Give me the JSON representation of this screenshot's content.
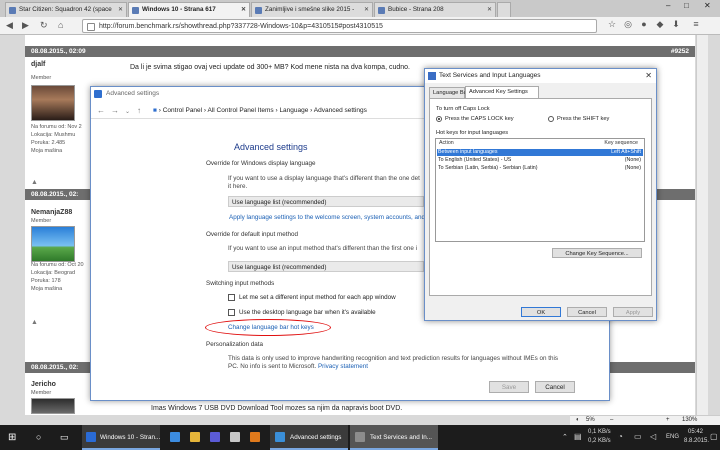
{
  "browser": {
    "tabs": [
      {
        "label": "Star Citizen: Squadron 42 (space"
      },
      {
        "label": "Windows 10 - Strana 617"
      },
      {
        "label": "Zanimljive i smešne slike 2015 -"
      },
      {
        "label": "Bubice - Strana 208"
      }
    ],
    "url": "http://forum.benchmark.rs/showthread.php?337728-Windows-10&p=4310515#post4310515"
  },
  "forum": {
    "posts": [
      {
        "date": "08.08.2015., 02:09",
        "number": "#9252",
        "username": "djalf",
        "role": "Member",
        "meta": [
          "Na forumu od: Nov 2",
          "Lokacija: Mushmu",
          "Poruka: 2.485",
          "Moja mašina"
        ],
        "text": "Da li je svima stigao ovaj veci update od 300+ MB? Kod mene nista na dva kompa, cudno."
      },
      {
        "date": "08.08.2015., 02:",
        "username": "NemanjaZ88",
        "role": "Member",
        "meta": [
          "Na forumu od: Oct 20",
          "Lokacija: Beograd",
          "Poruka: 178",
          "Moja mašina"
        ]
      },
      {
        "date": "08.08.2015., 02:",
        "username": "Jericho",
        "role": "Member",
        "text": "Imas Windows 7 USB DVD Download Tool mozes sa njim da napravis boot DVD."
      }
    ]
  },
  "advanced_settings": {
    "title": "Advanced settings",
    "breadcrumbs": [
      "Control Panel",
      "All Control Panel Items",
      "Language",
      "Advanced settings"
    ],
    "heading": "Advanced settings",
    "override_display": {
      "title": "Override for Windows display language",
      "desc": "If you want to use a display language that's different than the one det",
      "desc2": "it here.",
      "select": "Use language list (recommended)",
      "link": "Apply language settings to the welcome screen, system accounts, and"
    },
    "override_input": {
      "title": "Override for default input method",
      "desc": "If you want to use an input method that's different than the first one i",
      "select": "Use language list (recommended)"
    },
    "switching": {
      "title": "Switching input methods",
      "opt1": "Let me set a different input method for each app window",
      "opt2": "Use the desktop language bar when it's available",
      "hotkeys_link": "Change language bar hot keys"
    },
    "personalization": {
      "title": "Personalization data",
      "desc": "This data is only used to improve handwriting recognition and text prediction results for languages without IMEs on this",
      "desc2": "PC. No info is sent to Microsoft.",
      "privacy_link": "Privacy statement"
    },
    "save": "Save",
    "cancel": "Cancel"
  },
  "text_services": {
    "title": "Text Services and Input Languages",
    "tabs": [
      "Language Bar",
      "Advanced Key Settings"
    ],
    "caps_group": "To turn off Caps Lock",
    "caps_opt1": "Press the CAPS LOCK key",
    "caps_opt2": "Press the SHIFT key",
    "hotkeys_group": "Hot keys for input languages",
    "col_action": "Action",
    "col_key": "Key sequence",
    "rows": [
      {
        "action": "Between input languages",
        "key": "Left Alt+Shift"
      },
      {
        "action": "To English (United States) - US",
        "key": "(None)"
      },
      {
        "action": "To Serbian (Latin, Serbia) - Serbian (Latin)",
        "key": "(None)"
      }
    ],
    "change_btn": "Change Key Sequence...",
    "ok": "OK",
    "cancel": "Cancel",
    "apply": "Apply"
  },
  "taskbar": {
    "items": [
      "Windows 10 - Stran...",
      "Advanced settings",
      "Text Services and In..."
    ],
    "net_up": "0,1 KB/s",
    "net_down": "0,2 KB/s",
    "lang": "ENG",
    "time": "05:42",
    "date": "8.8.2015."
  },
  "statusbar": {
    "zoom_pct": "5%",
    "zoom": "130%"
  }
}
